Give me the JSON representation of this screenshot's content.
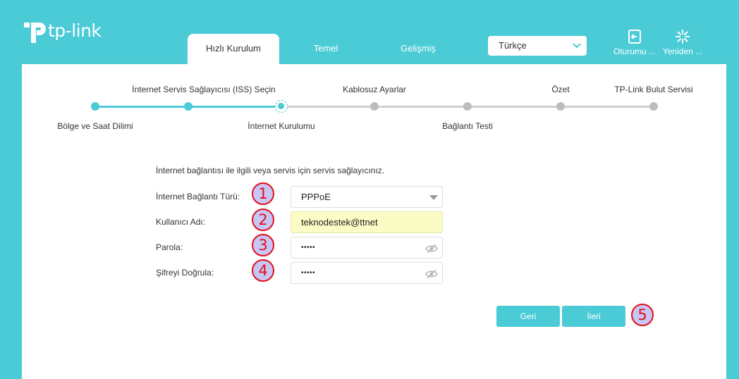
{
  "brand": {
    "name": "tp-link"
  },
  "tabs": [
    {
      "label": "Hızlı Kurulum",
      "active": true
    },
    {
      "label": "Temel",
      "active": false
    },
    {
      "label": "Gelişmiş",
      "active": false
    }
  ],
  "language": {
    "selected": "Türkçe"
  },
  "header_buttons": {
    "logout": "Oturumu ...",
    "reboot": "Yeniden ..."
  },
  "wizard": {
    "steps": [
      {
        "label": "Bölge ve Saat Dilimi",
        "state": "done"
      },
      {
        "label": "İnternet Servis Sağlayıcısı (ISS) Seçin",
        "state": "done"
      },
      {
        "label": "İnternet Kurulumu",
        "state": "current"
      },
      {
        "label": "Kablosuz Ayarlar",
        "state": "todo"
      },
      {
        "label": "Bağlantı Testi",
        "state": "todo"
      },
      {
        "label": "Özet",
        "state": "todo"
      },
      {
        "label": "TP-Link Bulut Servisi",
        "state": "todo"
      }
    ]
  },
  "form": {
    "intro": "İnternet bağlantısı ile ilgili veya servis için servis sağlayıcınız.",
    "connection_type": {
      "label": "İnternet Bağlantı Türü:",
      "value": "PPPoE"
    },
    "username": {
      "label": "Kullanıcı Adı:",
      "value": "teknodestek@ttnet"
    },
    "password": {
      "label": "Parola:",
      "value": "•••••"
    },
    "confirm_password": {
      "label": "Şifreyi Doğrula:",
      "value": "•••••"
    }
  },
  "buttons": {
    "back": "Geri",
    "next": "İleri"
  },
  "annotations": [
    "1",
    "2",
    "3",
    "4",
    "5"
  ],
  "colors": {
    "accent": "#4acbd6",
    "annotation": "#e0101a",
    "annotation_fill": "#c8c6f5",
    "filled_field": "#fbfbc6"
  }
}
